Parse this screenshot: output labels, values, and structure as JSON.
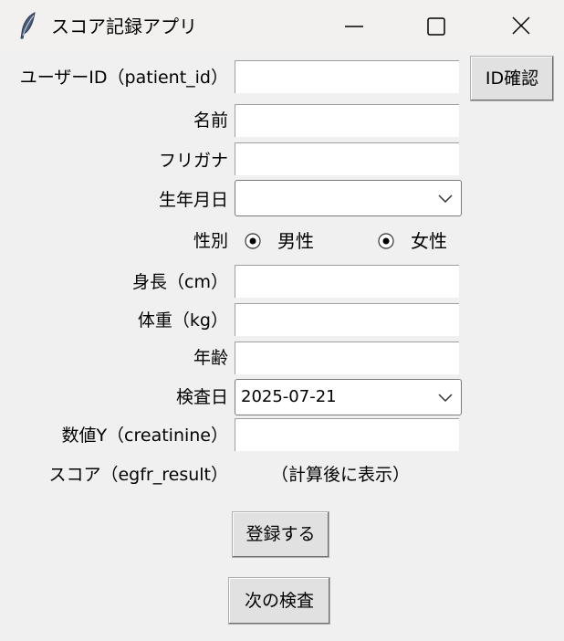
{
  "window": {
    "title": "スコア記録アプリ",
    "icon": "feather-icon",
    "controls": [
      "minimize-icon",
      "maximize-icon",
      "close-icon"
    ]
  },
  "form": {
    "patient_id": {
      "label": "ユーザーID（patient_id）",
      "value": ""
    },
    "id_check_button": "ID確認",
    "name": {
      "label": "名前",
      "value": ""
    },
    "furigana": {
      "label": "フリガナ",
      "value": ""
    },
    "birthdate": {
      "label": "生年月日",
      "value": ""
    },
    "gender": {
      "label": "性別",
      "options": [
        "男性",
        "女性"
      ]
    },
    "height": {
      "label": "身長（cm）",
      "value": ""
    },
    "weight": {
      "label": "体重（kg）",
      "value": ""
    },
    "age": {
      "label": "年齢",
      "value": ""
    },
    "exam_date": {
      "label": "検査日",
      "value": "2025-07-21"
    },
    "creatinine": {
      "label": "数値Y（creatinine）",
      "value": ""
    },
    "score": {
      "label": "スコア（egfr_result）",
      "value": "（計算後に表示）"
    }
  },
  "actions": {
    "register": "登録する",
    "next_exam": "次の検査"
  }
}
